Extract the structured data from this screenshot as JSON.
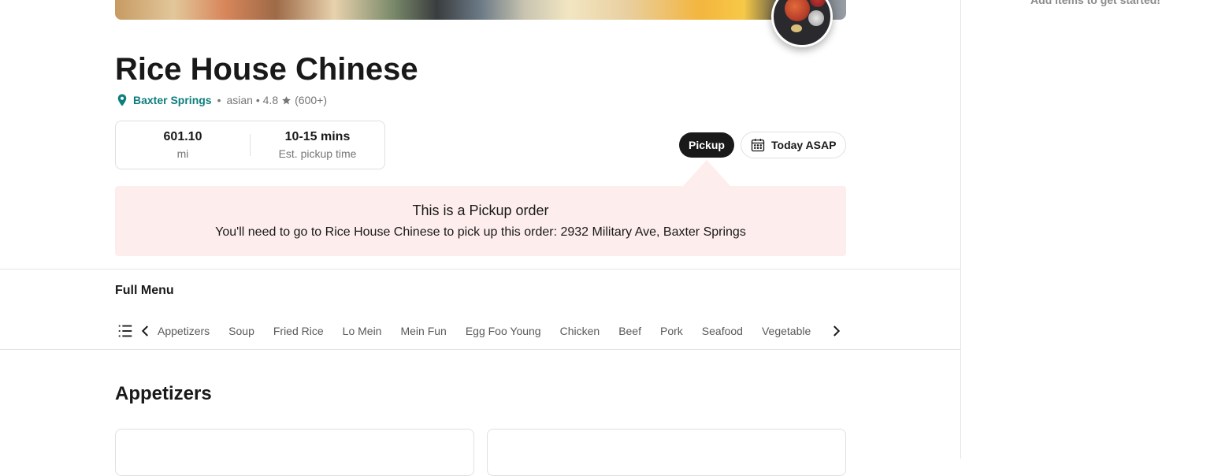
{
  "restaurant": {
    "name": "Rice House Chinese",
    "location": "Baxter Springs",
    "separator": "•",
    "cuisine": "asian • 4.8",
    "reviews": "(600+)"
  },
  "stats": {
    "distance_value": "601.10",
    "distance_label": "mi",
    "time_value": "10-15 mins",
    "time_label": "Est. pickup time"
  },
  "controls": {
    "pickup_label": "Pickup",
    "schedule_label": "Today ASAP"
  },
  "banner": {
    "title": "This is a Pickup order",
    "subtitle": "You'll need to go to Rice House Chinese to pick up this order: 2932 Military Ave, Baxter Springs"
  },
  "menu": {
    "heading": "Full Menu",
    "categories": [
      "Appetizers",
      "Soup",
      "Fried Rice",
      "Lo Mein",
      "Mein Fun",
      "Egg Foo Young",
      "Chicken",
      "Beef",
      "Pork",
      "Seafood",
      "Vegetable"
    ],
    "section_title": "Appetizers"
  },
  "cart": {
    "empty_text": "Add items to get started!"
  },
  "colors": {
    "accent_teal": "#0d7e7e",
    "banner_bg": "#fdeeed",
    "dark_button": "#191919"
  },
  "icons": {
    "location": "location-pin-icon",
    "rating": "star-icon",
    "schedule": "calendar-icon",
    "menu_list": "list-icon",
    "prev": "chevron-left-icon",
    "next": "chevron-right-icon"
  }
}
